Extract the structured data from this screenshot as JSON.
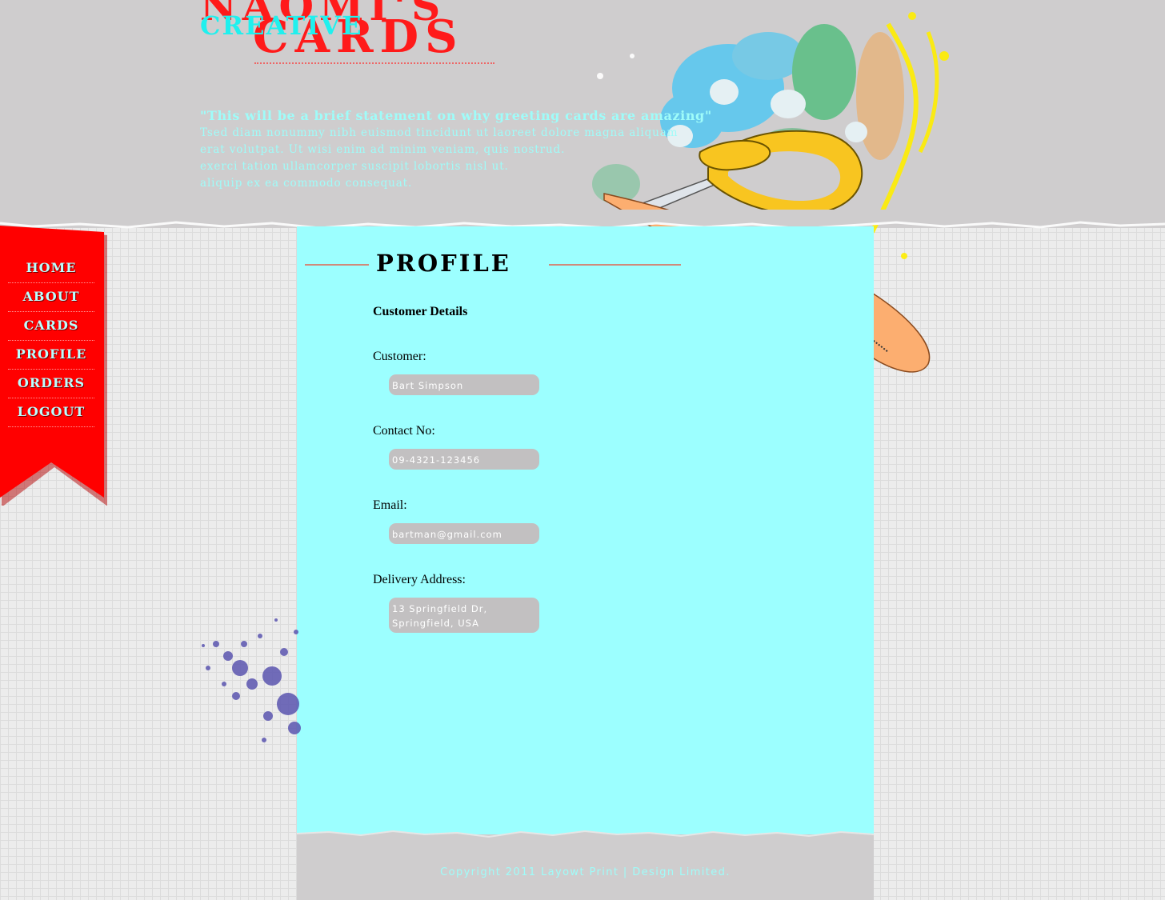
{
  "site": {
    "logo_line1": "NAOMI'S",
    "logo_line2": "CARDS",
    "logo_overlay": "CREATIVE"
  },
  "statement": {
    "title": "\"This will be a brief statement on why greeting cards are amazing\"",
    "lines": [
      "Tsed diam nonummy nibh euismod tincidunt ut laoreet dolore magna aliquam",
      "erat volutpat. Ut wisi enim ad minim veniam, quis nostrud.",
      "exerci tation ullamcorper suscipit lobortis nisl ut.",
      "aliquip ex ea commodo consequat."
    ]
  },
  "nav": {
    "items": [
      {
        "label": "HOME"
      },
      {
        "label": "ABOUT"
      },
      {
        "label": "CARDS"
      },
      {
        "label": "PROFILE"
      },
      {
        "label": "ORDERS"
      },
      {
        "label": "LOGOUT"
      }
    ]
  },
  "page": {
    "title": "PROFILE",
    "section_heading": "Customer Details"
  },
  "fields": {
    "customer": {
      "label": "Customer:",
      "value": "Bart Simpson"
    },
    "contact": {
      "label": "Contact No:",
      "value": "09-4321-123456"
    },
    "email": {
      "label": "Email:",
      "value": "bartman@gmail.com"
    },
    "address": {
      "label": "Delivery Address:",
      "value_line1": "13 Springfield Dr,",
      "value_line2": "Springfield, USA"
    }
  },
  "footer": {
    "copyright": "Copyright 2011 Layowt Print | Design Limited."
  },
  "colors": {
    "brand_red": "#ff1a1a",
    "cyan": "#9cffff",
    "header_gray": "#cfcdce"
  }
}
